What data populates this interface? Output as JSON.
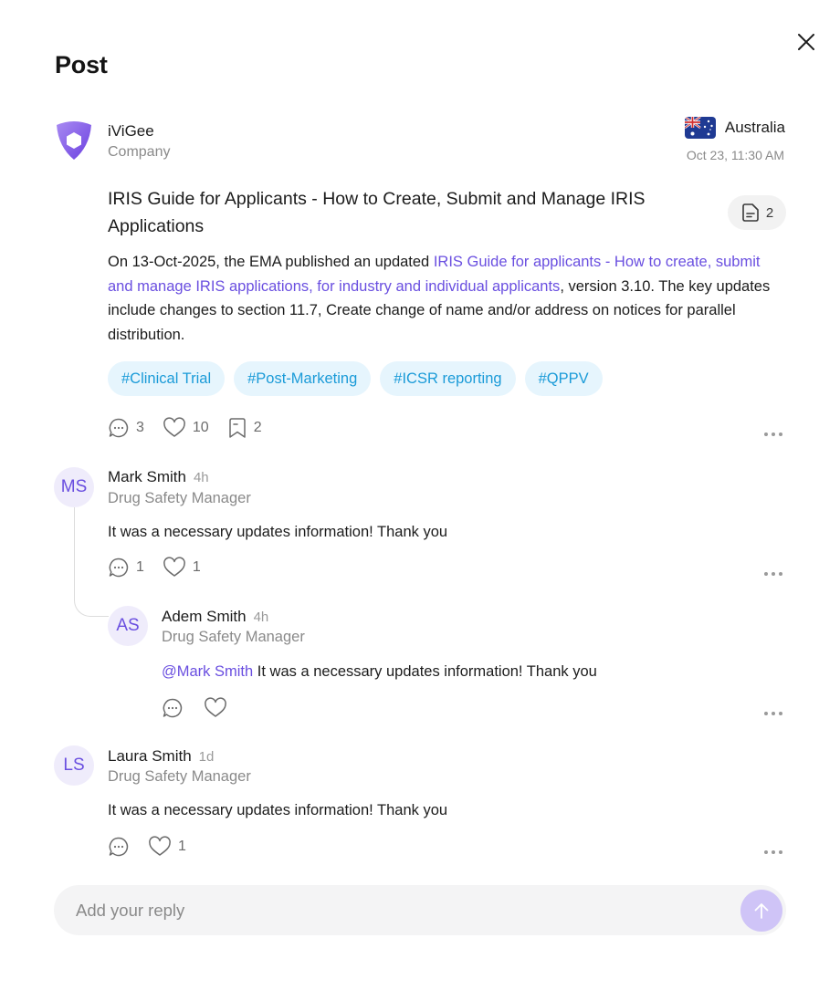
{
  "modal": {
    "title": "Post"
  },
  "post": {
    "author": {
      "name": "iViGee",
      "type": "Company"
    },
    "country": "Australia",
    "date": "Oct 23, 11:30 AM",
    "title": "IRIS Guide for Applicants - How to Create, Submit and Manage IRIS Applications",
    "attachments_count": "2",
    "body": {
      "part1": "On 13-Oct-2025, the EMA published an updated ",
      "link": "IRIS Guide for applicants - How to create, submit and manage IRIS applications, for industry and individual applicants",
      "part2": ", version 3.10. The key updates include changes to section 11.7, Create change of name and/or address on notices for parallel distribution."
    },
    "tags": [
      "#Clinical Trial",
      "#Post-Marketing",
      "#ICSR reporting",
      "#QPPV"
    ],
    "stats": {
      "comments": "3",
      "likes": "10",
      "saves": "2"
    }
  },
  "comments": [
    {
      "initials": "MS",
      "name": "Mark Smith",
      "time": "4h",
      "role": "Drug Safety Manager",
      "text": "It was a necessary updates information! Thank you",
      "replies_count": "1",
      "likes_count": "1"
    },
    {
      "initials": "AS",
      "name": "Adem Smith",
      "time": "4h",
      "role": "Drug Safety Manager",
      "mention": "@Mark Smith",
      "text": "It was a necessary updates information! Thank you"
    },
    {
      "initials": "LS",
      "name": "Laura Smith",
      "time": "1d",
      "role": "Drug Safety Manager",
      "text": "It was a necessary updates information! Thank you",
      "likes_count": "1"
    }
  ],
  "reply": {
    "placeholder": "Add your reply"
  },
  "icons": {
    "close": "close-icon",
    "logo": "ivigee-logo",
    "flag": "australia-flag-icon",
    "document": "document-icon",
    "comment": "comment-icon",
    "heart": "heart-icon",
    "bookmark": "bookmark-icon",
    "more": "more-dots-icon",
    "send": "arrow-up-icon"
  },
  "colors": {
    "accent": "#6a4fe0",
    "tag_bg": "#e6f5fd",
    "tag_text": "#1b9bd8",
    "send_bg": "#cfc4f7"
  }
}
